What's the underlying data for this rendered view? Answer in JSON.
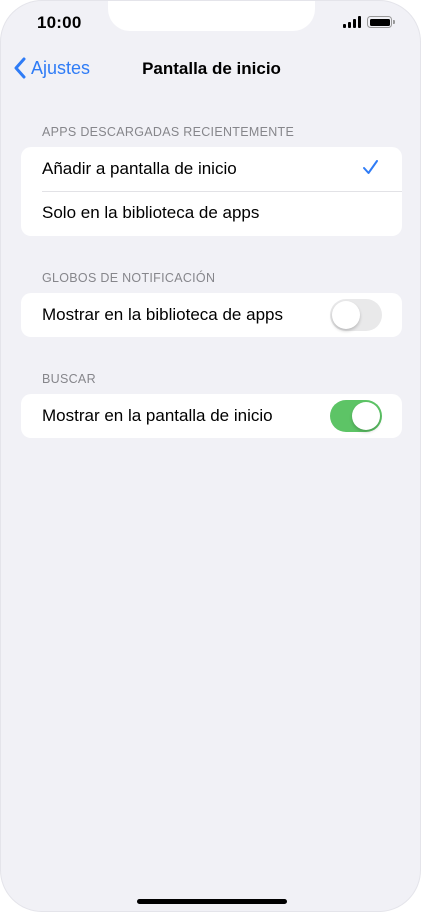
{
  "status_bar": {
    "time": "10:00"
  },
  "nav": {
    "back_label": "Ajustes",
    "title": "Pantalla de inicio"
  },
  "sections": {
    "recent_apps": {
      "header": "APPS DESCARGADAS RECIENTEMENTE",
      "options": [
        {
          "label": "Añadir a pantalla de inicio",
          "selected": true
        },
        {
          "label": "Solo en la biblioteca de apps",
          "selected": false
        }
      ]
    },
    "badges": {
      "header": "GLOBOS DE NOTIFICACIÓN",
      "label": "Mostrar en la biblioteca de apps",
      "enabled": false
    },
    "search": {
      "header": "BUSCAR",
      "label": "Mostrar en la pantalla de inicio",
      "enabled": true
    }
  },
  "colors": {
    "accent": "#2f7cf6",
    "toggle_on": "#5dc466",
    "toggle_off": "#e9e9ea",
    "background": "#f1f1f6"
  },
  "icons": {
    "back": "chevron-left-icon",
    "check": "checkmark-icon",
    "signal": "cellular-signal-icon",
    "battery": "battery-icon"
  }
}
